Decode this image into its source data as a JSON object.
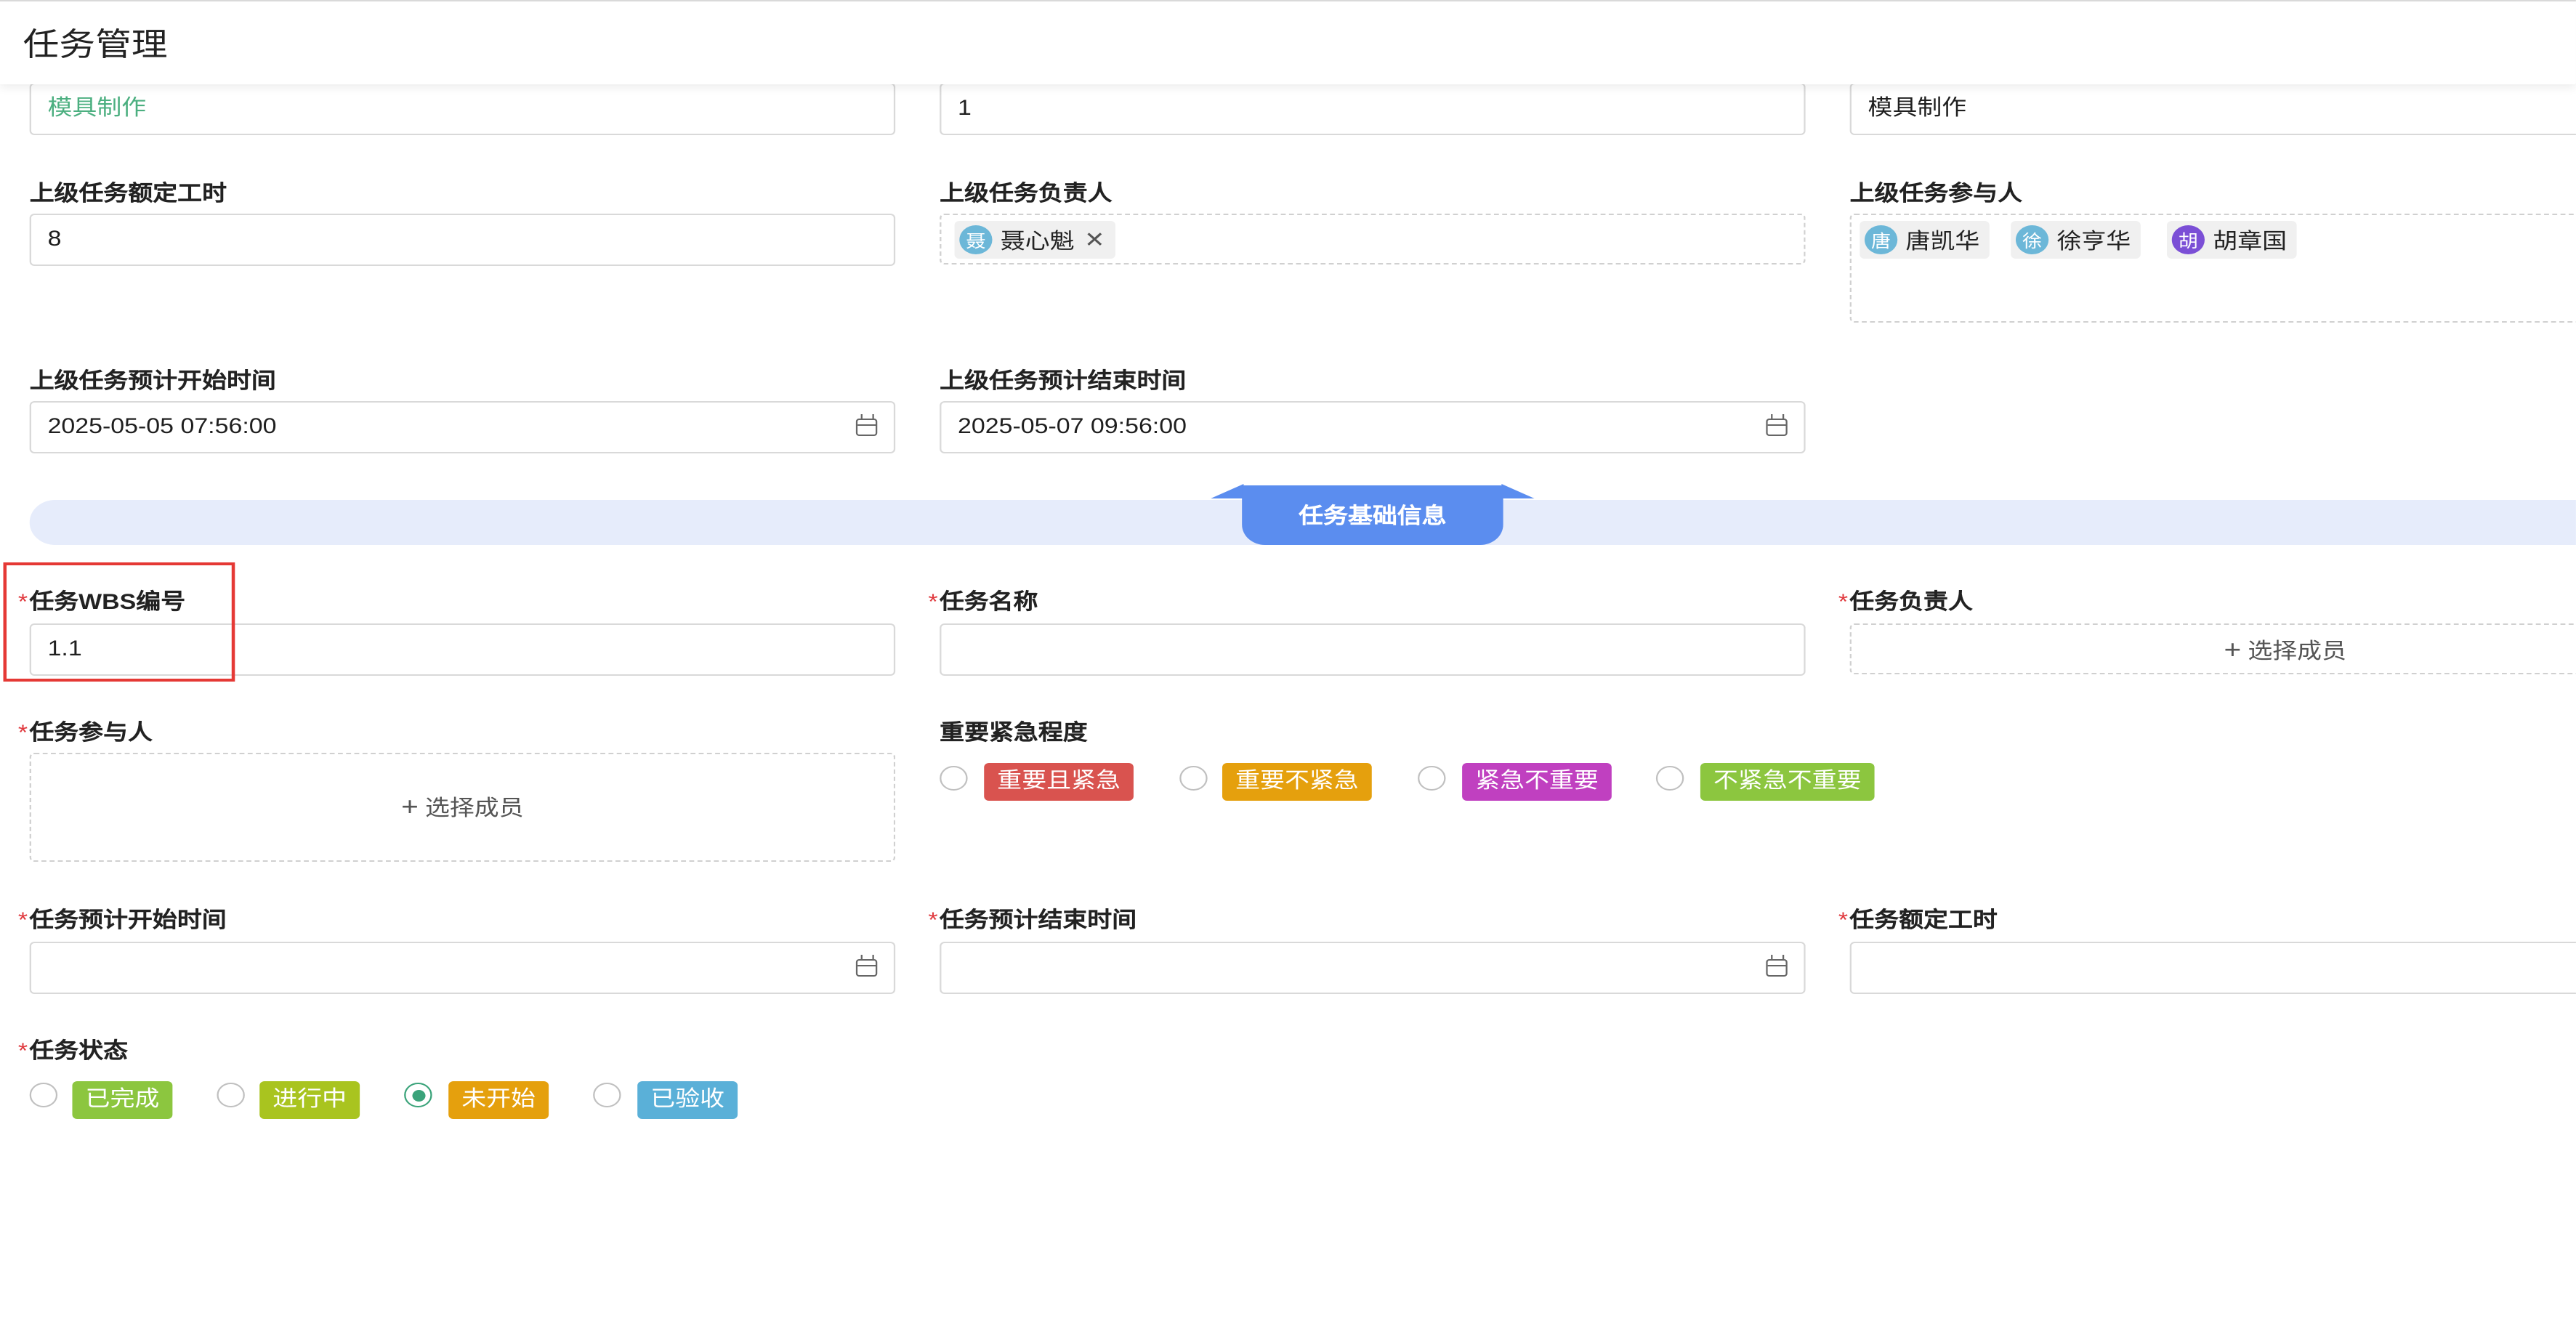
{
  "header": {
    "title": "任务管理"
  },
  "top_row": {
    "field1_value": "模具制作",
    "field2_value": "1",
    "field3_value": "模具制作"
  },
  "parent": {
    "hours_label": "上级任务额定工时",
    "hours_value": "8",
    "owner_label": "上级任务负责人",
    "owner": {
      "avatar": "聂",
      "name": "聂心魁",
      "avatar_color": "#6cb7d8"
    },
    "participants_label": "上级任务参与人",
    "participants": [
      {
        "avatar": "唐",
        "name": "唐凯华",
        "avatar_color": "#6cb7d8"
      },
      {
        "avatar": "徐",
        "name": "徐亨华",
        "avatar_color": "#6cb7d8"
      },
      {
        "avatar": "胡",
        "name": "胡章国",
        "avatar_color": "#7b4fd6"
      }
    ],
    "start_label": "上级任务预计开始时间",
    "start_value": "2025-05-05 07:56:00",
    "end_label": "上级任务预计结束时间",
    "end_value": "2025-05-07 09:56:00"
  },
  "section": {
    "title": "任务基础信息"
  },
  "task": {
    "required_mark": "*",
    "wbs_label": "任务WBS编号",
    "wbs_value": "1.1",
    "name_label": "任务名称",
    "name_value": "",
    "owner_label": "任务负责人",
    "participants_label": "任务参与人",
    "select_member": "选择成员",
    "priority_label": "重要紧急程度",
    "priority_options": [
      {
        "label": "重要且紧急",
        "color": "#d9534f"
      },
      {
        "label": "重要不紧急",
        "color": "#e5a00d"
      },
      {
        "label": "紧急不重要",
        "color": "#c040c0"
      },
      {
        "label": "不紧急不重要",
        "color": "#8cc63f"
      }
    ],
    "start_label": "任务预计开始时间",
    "end_label": "任务预计结束时间",
    "hours_label": "任务额定工时",
    "status_label": "任务状态",
    "status_options": [
      {
        "label": "已完成",
        "color": "#8cc63f",
        "selected": false
      },
      {
        "label": "进行中",
        "color": "#a9c41f",
        "selected": false
      },
      {
        "label": "未开始",
        "color": "#e5a00d",
        "selected": true
      },
      {
        "label": "已验收",
        "color": "#5ab0d8",
        "selected": false
      }
    ]
  }
}
